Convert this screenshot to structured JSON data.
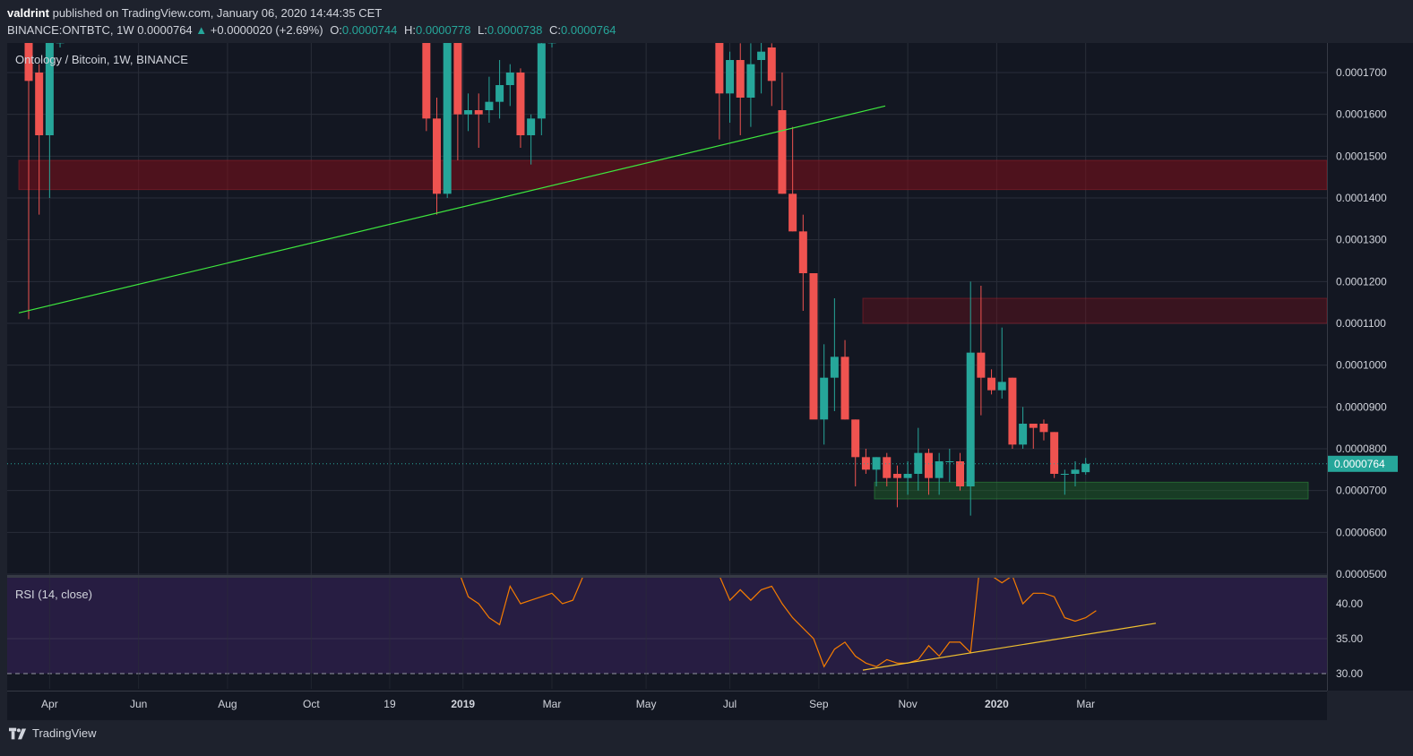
{
  "header": {
    "author": "valdrint",
    "published": "published on TradingView.com, January 06, 2020 14:44:35 CET",
    "symbol": "BINANCE:ONTBTC, 1W",
    "last": "0.0000764",
    "change_arrow": "▲",
    "change": "+0.0000020 (+2.69%)",
    "o_label": "O:",
    "o_value": "0.0000744",
    "h_label": "H:",
    "h_value": "0.0000778",
    "l_label": "L:",
    "l_value": "0.0000738",
    "c_label": "C:",
    "c_value": "0.0000764"
  },
  "footer": {
    "brand": "TradingView",
    "logo_icon": "tradingview-logo-icon"
  },
  "colors": {
    "background": "#131722",
    "grid": "#2a2e39",
    "up": "#26a69a",
    "down": "#ef5350",
    "trendline": "#3ee83e",
    "rsi_line": "#f57c00",
    "rsi_trend": "#f0c030",
    "rsi_band": "#2a1e46",
    "resistance_zone": "#800f19",
    "support_zone": "#1f6b2b"
  },
  "chart_data": [
    {
      "type": "candlestick",
      "title": "Ontology / Bitcoin, 1W, BINANCE",
      "x_ticks": [
        "Apr",
        "Jun",
        "Aug",
        "Oct",
        "19",
        "2019",
        "Mar",
        "May",
        "Jul",
        "Sep",
        "Nov",
        "2020",
        "Mar"
      ],
      "x_tick_weeks": [
        2,
        10.5,
        19,
        27,
        34.5,
        41.5,
        50,
        59,
        67,
        75.5,
        84,
        92.5,
        101
      ],
      "y_ticks": [
        "0.0000500",
        "0.0000600",
        "0.0000700",
        "0.0000800",
        "0.0000900",
        "0.0001000",
        "0.0001100",
        "0.0001200",
        "0.0001300",
        "0.0001400",
        "0.0001500",
        "0.0001600",
        "0.0001700"
      ],
      "ylim": [
        5e-05,
        0.000179
      ],
      "last_price_label": "0.0000764",
      "last_price": 7.64e-05,
      "candles": [
        {
          "w": 0,
          "o": 0.000178,
          "h": 0.00018,
          "l": 0.000111,
          "c": 0.000168
        },
        {
          "w": 1,
          "o": 0.00017,
          "h": 0.000172,
          "l": 0.000136,
          "c": 0.000155
        },
        {
          "w": 2,
          "o": 0.000155,
          "h": 0.000179,
          "l": 0.00014,
          "c": 0.000179
        },
        {
          "w": 3,
          "o": 0.000177,
          "h": 0.000179,
          "l": 0.000176,
          "c": 0.000179
        },
        {
          "w": 38,
          "o": 0.000179,
          "h": 0.000179,
          "l": 0.000156,
          "c": 0.000159
        },
        {
          "w": 39,
          "o": 0.000159,
          "h": 0.000164,
          "l": 0.000136,
          "c": 0.000141
        },
        {
          "w": 40,
          "o": 0.000141,
          "h": 0.000179,
          "l": 0.00014,
          "c": 0.000179
        },
        {
          "w": 41,
          "o": 0.000179,
          "h": 0.000179,
          "l": 0.000149,
          "c": 0.00016
        },
        {
          "w": 42,
          "o": 0.00016,
          "h": 0.000165,
          "l": 0.000156,
          "c": 0.000161
        },
        {
          "w": 43,
          "o": 0.000161,
          "h": 0.000165,
          "l": 0.000152,
          "c": 0.00016
        },
        {
          "w": 44,
          "o": 0.000161,
          "h": 0.000169,
          "l": 0.000158,
          "c": 0.000163
        },
        {
          "w": 45,
          "o": 0.000163,
          "h": 0.000173,
          "l": 0.000159,
          "c": 0.000167
        },
        {
          "w": 46,
          "o": 0.000167,
          "h": 0.000172,
          "l": 0.000162,
          "c": 0.00017
        },
        {
          "w": 47,
          "o": 0.00017,
          "h": 0.000171,
          "l": 0.000152,
          "c": 0.000155
        },
        {
          "w": 48,
          "o": 0.000155,
          "h": 0.00016,
          "l": 0.000148,
          "c": 0.000159
        },
        {
          "w": 49,
          "o": 0.000159,
          "h": 0.000179,
          "l": 0.000155,
          "c": 0.000177
        },
        {
          "w": 50,
          "o": 0.000177,
          "h": 0.000179,
          "l": 0.000176,
          "c": 0.000178
        },
        {
          "w": 66,
          "o": 0.000179,
          "h": 0.000179,
          "l": 0.000154,
          "c": 0.000165
        },
        {
          "w": 67,
          "o": 0.000165,
          "h": 0.000175,
          "l": 0.000158,
          "c": 0.000173
        },
        {
          "w": 68,
          "o": 0.000173,
          "h": 0.000177,
          "l": 0.000155,
          "c": 0.000164
        },
        {
          "w": 69,
          "o": 0.000164,
          "h": 0.000177,
          "l": 0.000157,
          "c": 0.000172
        },
        {
          "w": 70,
          "o": 0.000173,
          "h": 0.000178,
          "l": 0.000165,
          "c": 0.000175
        },
        {
          "w": 71,
          "o": 0.000176,
          "h": 0.000177,
          "l": 0.000162,
          "c": 0.000168
        },
        {
          "w": 72,
          "o": 0.000161,
          "h": 0.00017,
          "l": 0.000141,
          "c": 0.000141
        },
        {
          "w": 73,
          "o": 0.000141,
          "h": 0.000157,
          "l": 0.000132,
          "c": 0.000132
        },
        {
          "w": 74,
          "o": 0.000132,
          "h": 0.000136,
          "l": 0.000113,
          "c": 0.000122
        },
        {
          "w": 75,
          "o": 0.000122,
          "h": 0.000122,
          "l": 8.8e-05,
          "c": 8.7e-05
        },
        {
          "w": 76,
          "o": 8.7e-05,
          "h": 0.000105,
          "l": 8.1e-05,
          "c": 9.7e-05
        },
        {
          "w": 77,
          "o": 9.7e-05,
          "h": 0.000116,
          "l": 8.9e-05,
          "c": 0.000102
        },
        {
          "w": 78,
          "o": 0.000102,
          "h": 0.000106,
          "l": 8.7e-05,
          "c": 8.7e-05
        },
        {
          "w": 79,
          "o": 8.7e-05,
          "h": 8.7e-05,
          "l": 7.1e-05,
          "c": 7.8e-05
        },
        {
          "w": 80,
          "o": 7.8e-05,
          "h": 8e-05,
          "l": 7.4e-05,
          "c": 7.5e-05
        },
        {
          "w": 81,
          "o": 7.5e-05,
          "h": 7.8e-05,
          "l": 7.1e-05,
          "c": 7.8e-05
        },
        {
          "w": 82,
          "o": 7.8e-05,
          "h": 7.9e-05,
          "l": 7.1e-05,
          "c": 7.3e-05
        },
        {
          "w": 83,
          "o": 7.4e-05,
          "h": 7.6e-05,
          "l": 6.6e-05,
          "c": 7.3e-05
        },
        {
          "w": 84,
          "o": 7.3e-05,
          "h": 7.7e-05,
          "l": 6.9e-05,
          "c": 7.4e-05
        },
        {
          "w": 85,
          "o": 7.4e-05,
          "h": 8.5e-05,
          "l": 7e-05,
          "c": 7.9e-05
        },
        {
          "w": 86,
          "o": 7.9e-05,
          "h": 8e-05,
          "l": 6.9e-05,
          "c": 7.3e-05
        },
        {
          "w": 87,
          "o": 7.3e-05,
          "h": 7.9e-05,
          "l": 6.9e-05,
          "c": 7.7e-05
        },
        {
          "w": 88,
          "o": 7.7e-05,
          "h": 8e-05,
          "l": 7.2e-05,
          "c": 7.7e-05
        },
        {
          "w": 89,
          "o": 7.7e-05,
          "h": 7.9e-05,
          "l": 7e-05,
          "c": 7.1e-05
        },
        {
          "w": 90,
          "o": 7.1e-05,
          "h": 0.00012,
          "l": 6.4e-05,
          "c": 0.000103
        },
        {
          "w": 91,
          "o": 0.000103,
          "h": 0.000119,
          "l": 8.8e-05,
          "c": 9.7e-05
        },
        {
          "w": 92,
          "o": 9.7e-05,
          "h": 9.9e-05,
          "l": 9.3e-05,
          "c": 9.4e-05
        },
        {
          "w": 93,
          "o": 9.4e-05,
          "h": 0.000109,
          "l": 9.2e-05,
          "c": 9.6e-05
        },
        {
          "w": 94,
          "o": 9.7e-05,
          "h": 9.7e-05,
          "l": 8e-05,
          "c": 8.1e-05
        },
        {
          "w": 95,
          "o": 8.1e-05,
          "h": 9e-05,
          "l": 8e-05,
          "c": 8.6e-05
        },
        {
          "w": 96,
          "o": 8.6e-05,
          "h": 8.6e-05,
          "l": 8e-05,
          "c": 8.5e-05
        },
        {
          "w": 97,
          "o": 8.6e-05,
          "h": 8.7e-05,
          "l": 8.2e-05,
          "c": 8.4e-05
        },
        {
          "w": 98,
          "o": 8.4e-05,
          "h": 8.4e-05,
          "l": 7.3e-05,
          "c": 7.4e-05
        },
        {
          "w": 99,
          "o": 7.4e-05,
          "h": 7.5e-05,
          "l": 6.9e-05,
          "c": 7.4e-05
        },
        {
          "w": 100,
          "o": 7.4e-05,
          "h": 7.7e-05,
          "l": 7.1e-05,
          "c": 7.5e-05
        },
        {
          "w": 101,
          "o": 7.44e-05,
          "h": 7.78e-05,
          "l": 7.38e-05,
          "c": 7.64e-05
        }
      ],
      "resistance_zones": [
        {
          "w_start": 0,
          "w_end": 119,
          "low": 0.000142,
          "high": 0.000149
        },
        {
          "w_start": 77,
          "w_end": 119,
          "low": 0.00011,
          "high": 0.000116
        }
      ],
      "support_zone": {
        "w_start": 78,
        "w_end": 118,
        "low": 6.8e-05,
        "high": 7.2e-05
      },
      "trendline": {
        "w1": 0,
        "p1": 0.0001125,
        "w2": 80,
        "p2": 0.000162
      }
    },
    {
      "type": "line",
      "title": "RSI (14, close)",
      "y_ticks": [
        "30.00",
        "35.00",
        "40.00"
      ],
      "ylim": [
        28,
        43.5
      ],
      "band": [
        30,
        40
      ],
      "series": [
        {
          "w": 41,
          "v": 45
        },
        {
          "w": 42,
          "v": 41
        },
        {
          "w": 43,
          "v": 40
        },
        {
          "w": 44,
          "v": 38
        },
        {
          "w": 45,
          "v": 37
        },
        {
          "w": 46,
          "v": 42.5
        },
        {
          "w": 47,
          "v": 40
        },
        {
          "w": 48,
          "v": 40.5
        },
        {
          "w": 49,
          "v": 41
        },
        {
          "w": 50,
          "v": 41.5
        },
        {
          "w": 51,
          "v": 40
        },
        {
          "w": 52,
          "v": 40.5
        },
        {
          "w": 53,
          "v": 44
        },
        {
          "w": 66,
          "v": 44
        },
        {
          "w": 67,
          "v": 40.5
        },
        {
          "w": 68,
          "v": 42
        },
        {
          "w": 69,
          "v": 40.5
        },
        {
          "w": 70,
          "v": 42
        },
        {
          "w": 71,
          "v": 42.5
        },
        {
          "w": 72,
          "v": 40
        },
        {
          "w": 73,
          "v": 38
        },
        {
          "w": 74,
          "v": 36.5
        },
        {
          "w": 75,
          "v": 35
        },
        {
          "w": 76,
          "v": 31
        },
        {
          "w": 77,
          "v": 33.5
        },
        {
          "w": 78,
          "v": 34.5
        },
        {
          "w": 79,
          "v": 32.5
        },
        {
          "w": 80,
          "v": 31.5
        },
        {
          "w": 81,
          "v": 31
        },
        {
          "w": 82,
          "v": 32
        },
        {
          "w": 83,
          "v": 31.5
        },
        {
          "w": 84,
          "v": 31.5
        },
        {
          "w": 85,
          "v": 32
        },
        {
          "w": 86,
          "v": 34
        },
        {
          "w": 87,
          "v": 32.5
        },
        {
          "w": 88,
          "v": 34.5
        },
        {
          "w": 89,
          "v": 34.5
        },
        {
          "w": 90,
          "v": 33
        },
        {
          "w": 91,
          "v": 47
        },
        {
          "w": 92,
          "v": 44
        },
        {
          "w": 93,
          "v": 43
        },
        {
          "w": 94,
          "v": 44
        },
        {
          "w": 95,
          "v": 40
        },
        {
          "w": 96,
          "v": 41.5
        },
        {
          "w": 97,
          "v": 41.5
        },
        {
          "w": 98,
          "v": 41
        },
        {
          "w": 99,
          "v": 38
        },
        {
          "w": 100,
          "v": 37.5
        },
        {
          "w": 101,
          "v": 38
        },
        {
          "w": 102,
          "v": 39
        }
      ],
      "trendline": {
        "w1": 78,
        "v1": 30.5,
        "w2": 102,
        "v2": 37.2
      }
    }
  ]
}
